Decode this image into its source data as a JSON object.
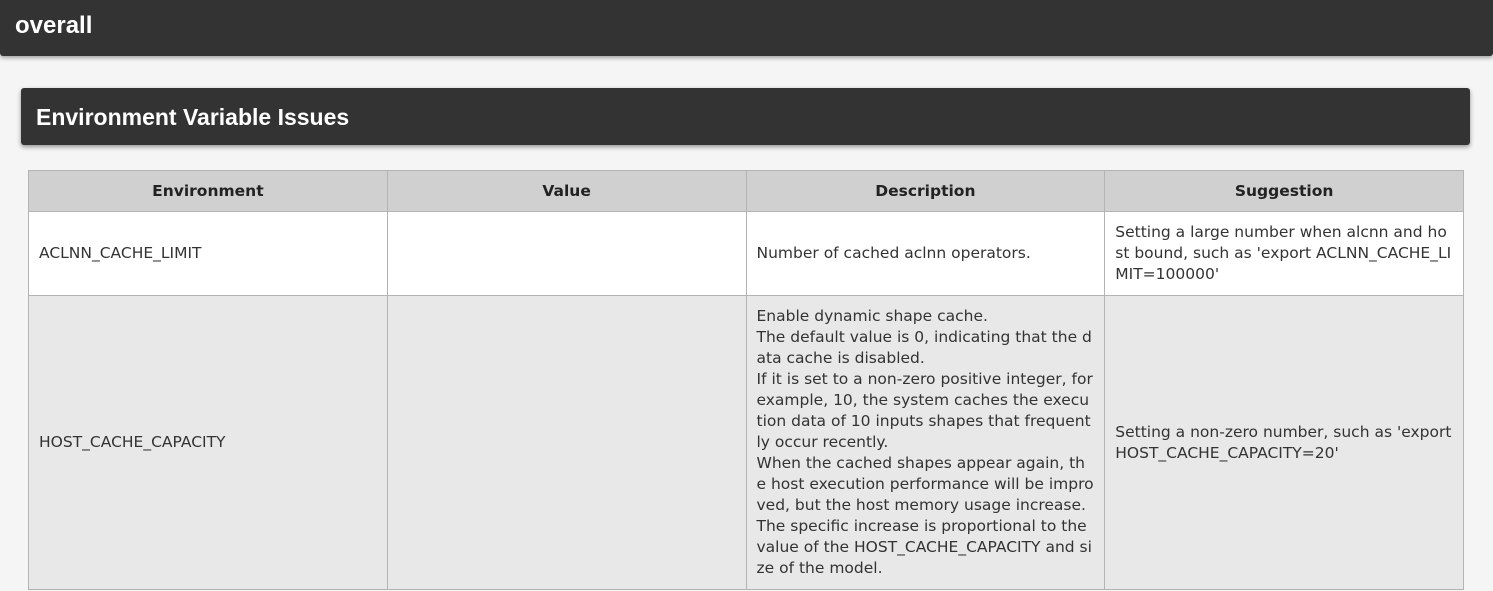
{
  "app": {
    "title": "overall"
  },
  "section": {
    "title": "Environment Variable Issues"
  },
  "table": {
    "columns": [
      "Environment",
      "Value",
      "Description",
      "Suggestion"
    ],
    "rows": [
      {
        "environment": "ACLNN_CACHE_LIMIT",
        "value": "",
        "description": [
          "Number of cached aclnn operators."
        ],
        "suggestion": "Setting a large number when alcnn and host bound, such as 'export ACLNN_CACHE_LIMIT=100000'"
      },
      {
        "environment": "HOST_CACHE_CAPACITY",
        "value": "",
        "description": [
          "Enable dynamic shape cache.",
          "The default value is 0, indicating that the data cache is disabled.",
          "If it is set to a non-zero positive integer, for example, 10, the system caches the execution data of 10 inputs shapes that frequently occur recently.",
          "When the cached shapes appear again, the host execution performance will be improved, but the host memory usage increase.",
          "The specific increase is proportional to the value of the HOST_CACHE_CAPACITY and size of the model."
        ],
        "suggestion": "Setting a non-zero number, such as 'export HOST_CACHE_CAPACITY=20'"
      }
    ]
  },
  "colors": {
    "header_bar": "#333333",
    "table_header": "#d0d0d0",
    "row_even": "#e8e8e8",
    "row_odd": "#ffffff"
  }
}
